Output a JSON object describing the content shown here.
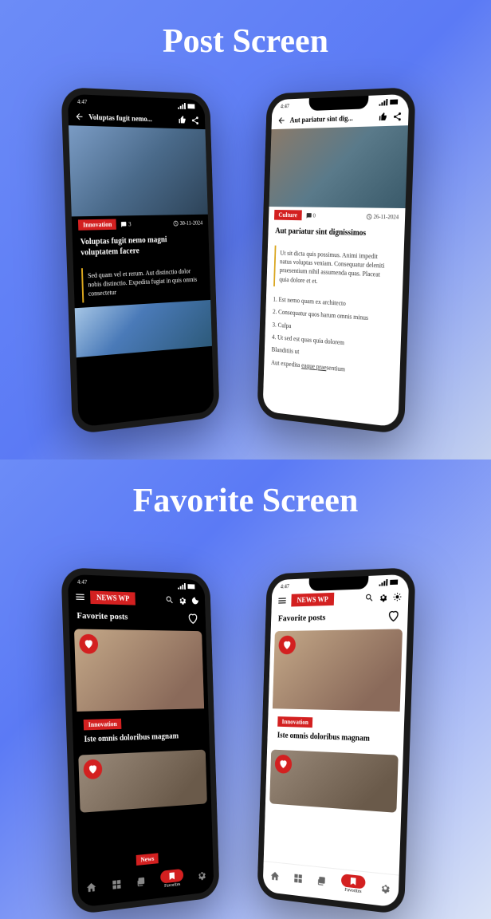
{
  "section_titles": {
    "top": "Post Screen",
    "bottom": "Favorite Screen"
  },
  "statusbar": {
    "time": "4:47"
  },
  "post_dark": {
    "appbar_title": "Voluptas fugit nemo...",
    "category": "Innovation",
    "comments": "3",
    "date": "30-11-2024",
    "title": "Voluptas fugit nemo magni voluptatem facere",
    "quote": "Sed quam vel et rerum. Aut distinctio dolor nobis distinctio. Expedita fugiat in quis omnis consectetur"
  },
  "post_light": {
    "appbar_title": "Aut pariatur sint dig...",
    "category": "Culture",
    "comments": "0",
    "date": "26-11-2024",
    "title": "Aut pariatur sint dignissimos",
    "quote": "Ut sit dicta quis possimus. Animi impedit natus voluptas veniam. Consequatur deleniti praesentium nihil assumenda quas. Placeat quia dolore et et.",
    "list": [
      "1. Est nemo quam ex architecto",
      "2. Consequatur quos harum omnis minus",
      "3. Culpa",
      "4. Ut sed est quas quia dolorem"
    ],
    "extra1": "Blanditiis ut",
    "extra2_a": "Aut expedita ",
    "extra2_b": "eaque prae",
    "extra2_c": "sentium"
  },
  "fav": {
    "brand": "NEWS WP",
    "heading": "Favorite posts",
    "card1": {
      "category": "Innovation",
      "title": "Iste omnis doloribus magnam"
    },
    "card2": {
      "category": "News"
    }
  },
  "nav": {
    "favorites_label": "Favorites"
  }
}
